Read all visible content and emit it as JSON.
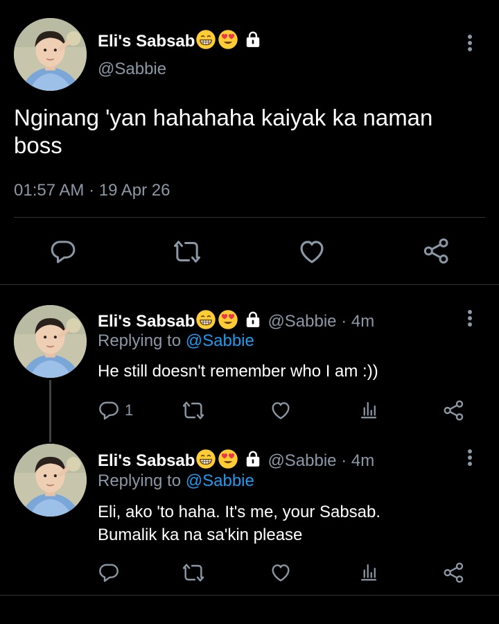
{
  "main_tweet": {
    "display_name": "Eli's Sabsab",
    "handle": "@Sabbie",
    "text": "Nginang 'yan hahahaha kaiyak ka naman boss",
    "timestamp": "01:57 AM · 19 Apr 26"
  },
  "replies": [
    {
      "display_name": "Eli's Sabsab",
      "handle_time": "@Sabbie · 4m",
      "replying_prefix": "Replying to",
      "replying_handle": "@Sabbie",
      "text": "He still doesn't remember who I am :))",
      "reply_count": "1"
    },
    {
      "display_name": "Eli's Sabsab",
      "handle_time": "@Sabbie · 4m",
      "replying_prefix": "Replying to",
      "replying_handle": "@Sabbie",
      "text_line1": "Eli, ako 'to haha. It's me, your Sabsab.",
      "text_line2": "Bumalik ka na sa'kin please",
      "reply_count": ""
    }
  ],
  "icons": [
    "grinning-face-emoji",
    "heart-eyes-emoji",
    "lock-icon",
    "more-icon",
    "reply-icon",
    "retweet-icon",
    "like-icon",
    "share-icon",
    "analytics-icon"
  ],
  "colors": {
    "background": "#000000",
    "muted": "#8b98a5",
    "link": "#1d9bf0",
    "divider": "#2f3336"
  }
}
